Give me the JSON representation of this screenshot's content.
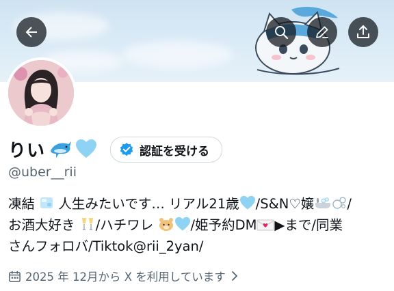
{
  "header": {
    "back_icon": "arrow-left-icon",
    "search_icon": "search-icon",
    "edit_icon": "pencil-icon",
    "share_icon": "share-icon"
  },
  "profile": {
    "display_name": "りい",
    "handle": "@uber__rii",
    "verify_button_label": "認証を受ける",
    "bio": {
      "line1_a": "凍結",
      "line1_b": "人生みたいです… リアル21歳",
      "line1_c": "/S&N♡嬢",
      "line1_d": "/",
      "line2_a": "お酒大好き",
      "line2_b": "/ハチワレ",
      "line2_c": "/姫予約DM",
      "line2_d": "▶まで/同業",
      "line3": "さんフォロバ/Tiktok@rii_2yan/"
    },
    "joined_text": "2025 年 12月から X を利用しています"
  },
  "colors": {
    "verified_blue": "#1d9bf0",
    "muted_text": "#536471",
    "heart_light_blue": "#8fd3f4"
  }
}
